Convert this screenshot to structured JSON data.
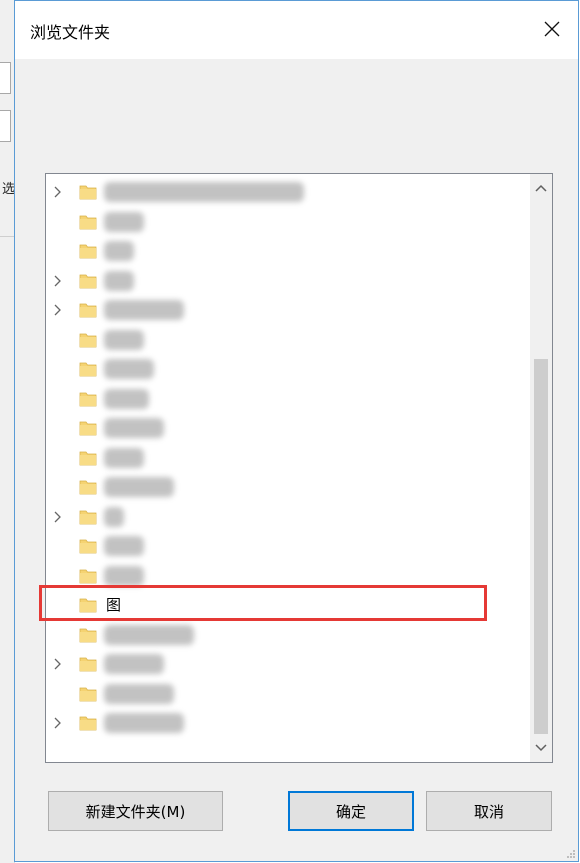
{
  "dialog": {
    "title": "浏览文件夹",
    "close_icon": "close-icon"
  },
  "background_window": {
    "partial_text": "选"
  },
  "tree": {
    "items": [
      {
        "expandable": true,
        "label": ""
      },
      {
        "expandable": false,
        "label": ""
      },
      {
        "expandable": false,
        "label": ""
      },
      {
        "expandable": true,
        "label": ""
      },
      {
        "expandable": true,
        "label": ""
      },
      {
        "expandable": false,
        "label": ""
      },
      {
        "expandable": false,
        "label": ""
      },
      {
        "expandable": false,
        "label": ""
      },
      {
        "expandable": false,
        "label": ""
      },
      {
        "expandable": false,
        "label": ""
      },
      {
        "expandable": false,
        "label": ""
      },
      {
        "expandable": true,
        "label": ""
      },
      {
        "expandable": false,
        "label": ""
      },
      {
        "expandable": false,
        "label": ""
      },
      {
        "expandable": false,
        "label": "图",
        "highlighted": true
      },
      {
        "expandable": false,
        "label": ""
      },
      {
        "expandable": true,
        "label": ""
      },
      {
        "expandable": false,
        "label": ""
      },
      {
        "expandable": true,
        "label": ""
      }
    ]
  },
  "buttons": {
    "new_folder": "新建文件夹(M)",
    "ok": "确定",
    "cancel": "取消"
  },
  "colors": {
    "folder": "#f5d372",
    "highlight_border": "#e53935",
    "focus_border": "#0078d7"
  }
}
